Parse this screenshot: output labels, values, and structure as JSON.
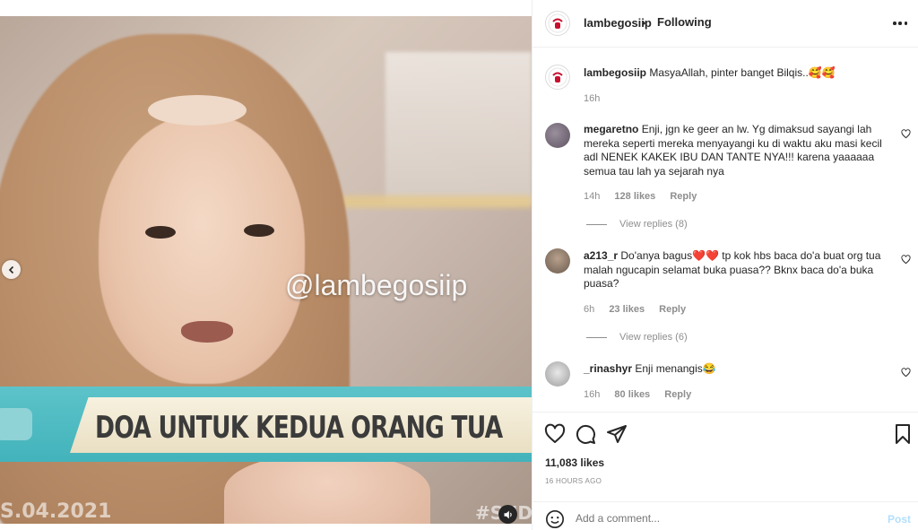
{
  "media": {
    "watermark": "@lambegosiip",
    "banner_text": "DOA UNTUK KEDUA ORANG TUA",
    "date_stamp": "S.04.2021",
    "hashtag": "#SUD"
  },
  "header": {
    "username": "lambegosiip",
    "separator": "•",
    "follow_status": "Following"
  },
  "caption": {
    "username": "lambegosiip",
    "text": "MasyaAllah, pinter banget Bilqis..",
    "emojis": "🥰🥰",
    "time": "16h"
  },
  "comments": [
    {
      "username": "megaretno",
      "text": "Enji, jgn ke geer an lw. Yg dimaksud sayangi lah mereka seperti mereka menyayangi ku di waktu aku masi kecil adl NENEK KAKEK IBU DAN TANTE NYA!!! karena yaaaaaa semua tau lah ya sejarah nya",
      "time": "14h",
      "likes": "128 likes",
      "reply": "Reply",
      "view_replies": "View replies (8)"
    },
    {
      "username": "a213_r",
      "text_before": "Do'anya bagus",
      "hearts": "❤️❤️",
      "text_after": " tp kok hbs baca do'a buat org tua malah ngucapin selamat buka puasa?? Bknx baca do'a buka puasa?",
      "time": "6h",
      "likes": "23 likes",
      "reply": "Reply",
      "view_replies": "View replies (6)"
    },
    {
      "username": "_rinashyr",
      "text": "Enji menangis",
      "emoji": "😂",
      "time": "16h",
      "likes": "80 likes",
      "reply": "Reply"
    }
  ],
  "actions": {
    "likes": "11,083 likes",
    "time_ago": "16 HOURS AGO"
  },
  "add_comment": {
    "placeholder": "Add a comment...",
    "post_label": "Post"
  },
  "colors": {
    "banner_teal": "#43b3bb",
    "post_disabled": "#b2dffc",
    "meta_gray": "#8e8e8e"
  }
}
